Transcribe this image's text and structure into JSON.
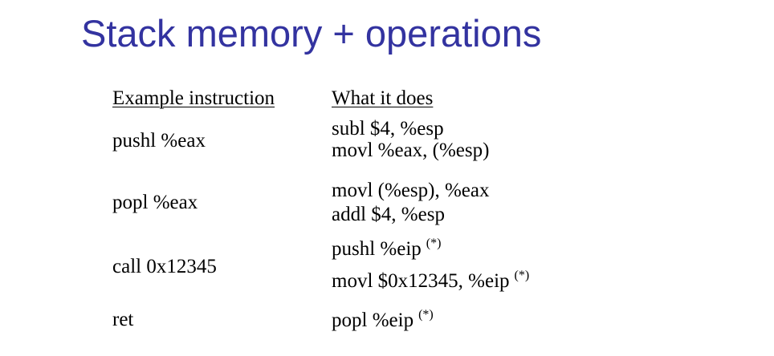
{
  "slide": {
    "title": "Stack memory + operations"
  },
  "table": {
    "headers": {
      "example": "Example instruction",
      "does": "What it does"
    },
    "rows": [
      {
        "example": "pushl %eax",
        "does": [
          {
            "text": "subl $4, %esp",
            "note": ""
          },
          {
            "text": "movl %eax, (%esp)",
            "note": ""
          }
        ]
      },
      {
        "example": "popl %eax",
        "does": [
          {
            "text": "movl (%esp), %eax",
            "note": ""
          },
          {
            "text": "addl $4, %esp",
            "note": ""
          }
        ]
      },
      {
        "example": "call 0x12345",
        "does": [
          {
            "text": "pushl %eip",
            "note": "(*)"
          },
          {
            "text": "movl $0x12345, %eip",
            "note": "(*)"
          }
        ]
      },
      {
        "example": "ret",
        "does": [
          {
            "text": "popl %eip",
            "note": "(*)"
          }
        ]
      }
    ]
  }
}
